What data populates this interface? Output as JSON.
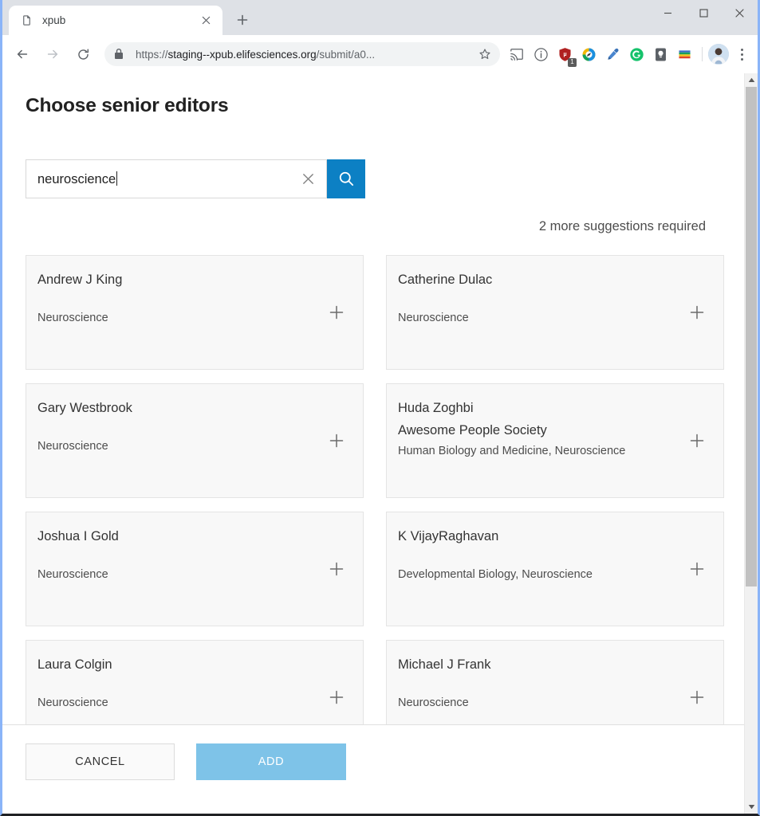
{
  "browser": {
    "tab": {
      "title": "xpub",
      "favicon_icon": "page-icon",
      "close_icon": "close-icon"
    },
    "new_tab_icon": "plus-icon",
    "window_controls": {
      "minimize": "minimize-icon",
      "maximize": "maximize-icon",
      "close": "close-icon"
    },
    "nav": {
      "back_icon": "arrow-left-icon",
      "forward_icon": "arrow-right-icon",
      "reload_icon": "reload-icon"
    },
    "omnibox": {
      "lock_icon": "lock-icon",
      "url_scheme": "https://",
      "url_host": "staging--xpub.elifesciences.org",
      "url_path": "/submit/a0...",
      "star_icon": "star-icon"
    },
    "extensions": [
      {
        "name": "cast-icon",
        "label": ""
      },
      {
        "name": "info-circle-icon",
        "label": ""
      },
      {
        "name": "ublock-origin-icon",
        "label": "1"
      },
      {
        "name": "color-wheel-icon",
        "label": ""
      },
      {
        "name": "eyedropper-icon",
        "label": ""
      },
      {
        "name": "grammarly-icon",
        "label": "G"
      },
      {
        "name": "lightbulb-icon",
        "label": ""
      },
      {
        "name": "color-bars-icon",
        "label": ""
      }
    ],
    "profile_avatar": "avatar",
    "menu_icon": "three-dots-icon"
  },
  "page": {
    "heading": "Choose senior editors",
    "search": {
      "value": "neuroscience",
      "placeholder": "",
      "clear_icon": "close-icon",
      "search_icon": "search-icon",
      "button_color": "#0c80c4"
    },
    "hint": "2 more suggestions required",
    "add_icon": "plus-icon",
    "editors": [
      {
        "name": "Andrew J King",
        "affiliation": "",
        "subjects": "Neuroscience"
      },
      {
        "name": "Catherine Dulac",
        "affiliation": "",
        "subjects": "Neuroscience"
      },
      {
        "name": "Gary Westbrook",
        "affiliation": "",
        "subjects": "Neuroscience"
      },
      {
        "name": "Huda Zoghbi",
        "affiliation": "Awesome People Society",
        "subjects": "Human Biology and Medicine, Neuroscience"
      },
      {
        "name": "Joshua I Gold",
        "affiliation": "",
        "subjects": "Neuroscience"
      },
      {
        "name": "K VijayRaghavan",
        "affiliation": "",
        "subjects": "Developmental Biology, Neuroscience"
      },
      {
        "name": "Laura Colgin",
        "affiliation": "",
        "subjects": "Neuroscience"
      },
      {
        "name": "Michael J Frank",
        "affiliation": "",
        "subjects": "Neuroscience"
      }
    ],
    "footer": {
      "cancel_label": "CANCEL",
      "add_label": "ADD",
      "add_color": "#7ec3e8"
    }
  },
  "scrollbar": {
    "up_icon": "triangle-up-icon",
    "down_icon": "triangle-down-icon",
    "thumb_position_percent": 0,
    "thumb_size_percent": 70
  }
}
